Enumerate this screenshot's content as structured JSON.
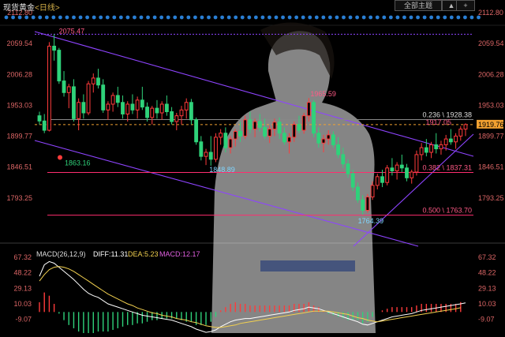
{
  "header": {
    "title": "现货黄金",
    "timeframe": "<日线>",
    "all_button": "全部主题",
    "up_button": "▲",
    "plus_button": "+"
  },
  "colors": {
    "background": "#000000",
    "up_candle": "#ff3b3b",
    "down_candle": "#2fd27a",
    "channel": "#8e44ff",
    "fib_line": "#ff2d6f",
    "fib_label": "#ff5a86",
    "diff": "#ffffff",
    "dea": "#f2d04f",
    "macd_pos": "#ff3b3b",
    "macd_neg": "#2fd27a",
    "dots": "#2a7fd4"
  },
  "chart_data": [
    {
      "type": "candlestick",
      "title": "现货黄金 日线",
      "y_ticks": [
        "2112.80",
        "2059.54",
        "2006.28",
        "1953.03",
        "1899.77",
        "1846.51",
        "1793.25"
      ],
      "right_ticks": [
        "2112.80",
        "2059.54",
        "2006.28",
        "1953.03",
        "1919.76",
        "1899.77",
        "1846.51",
        "1793.25"
      ],
      "ylim": [
        1740,
        2112.8
      ],
      "current_price": "1919.76",
      "annotations": [
        "2075.47",
        "1863.16",
        "1848.89",
        "1965.59",
        "1764.39",
        "1917.05"
      ],
      "fib_levels": [
        {
          "label": "0.236 \\ 1928.38",
          "value": 1928.38
        },
        {
          "label": "0.382 \\ 1837.31",
          "value": 1837.31
        },
        {
          "label": "0.500 \\ 1763.70",
          "value": 1763.7
        }
      ],
      "candles": [
        [
          1935,
          1942,
          1920,
          1926
        ],
        [
          1926,
          1938,
          1905,
          1910
        ],
        [
          1910,
          2062,
          1908,
          2055
        ],
        [
          2055,
          2075.47,
          2030,
          2048
        ],
        [
          2048,
          2052,
          1990,
          1995
        ],
        [
          1995,
          2012,
          1968,
          1975
        ],
        [
          1975,
          1990,
          1948,
          1985
        ],
        [
          1985,
          1998,
          1925,
          1930
        ],
        [
          1930,
          1965,
          1910,
          1958
        ],
        [
          1958,
          1972,
          1930,
          1940
        ],
        [
          1940,
          1995,
          1936,
          1990
        ],
        [
          1990,
          2008,
          1975,
          2000
        ],
        [
          2000,
          2016,
          1982,
          1988
        ],
        [
          1988,
          1998,
          1940,
          1945
        ],
        [
          1945,
          1960,
          1928,
          1955
        ],
        [
          1955,
          1975,
          1942,
          1970
        ],
        [
          1970,
          1985,
          1950,
          1958
        ],
        [
          1958,
          1970,
          1930,
          1938
        ],
        [
          1938,
          1960,
          1925,
          1955
        ],
        [
          1955,
          1972,
          1938,
          1945
        ],
        [
          1945,
          1968,
          1930,
          1962
        ],
        [
          1962,
          1985,
          1945,
          1950
        ],
        [
          1950,
          1958,
          1925,
          1932
        ],
        [
          1932,
          1952,
          1920,
          1948
        ],
        [
          1948,
          1962,
          1930,
          1940
        ],
        [
          1940,
          1960,
          1928,
          1955
        ],
        [
          1955,
          1970,
          1935,
          1942
        ],
        [
          1942,
          1950,
          1920,
          1925
        ],
        [
          1925,
          1940,
          1910,
          1935
        ],
        [
          1935,
          1952,
          1920,
          1945
        ],
        [
          1945,
          1965,
          1930,
          1958
        ],
        [
          1958,
          1964,
          1920,
          1928
        ],
        [
          1928,
          1932,
          1885,
          1890
        ],
        [
          1890,
          1900,
          1858,
          1865
        ],
        [
          1865,
          1878,
          1850,
          1872
        ],
        [
          1872,
          1900,
          1848.89,
          1860
        ],
        [
          1860,
          1905,
          1855,
          1898
        ],
        [
          1898,
          1912,
          1885,
          1905
        ],
        [
          1905,
          1915,
          1872,
          1880
        ],
        [
          1880,
          1900,
          1870,
          1895
        ],
        [
          1895,
          1912,
          1882,
          1908
        ],
        [
          1908,
          1925,
          1890,
          1900
        ],
        [
          1900,
          1935,
          1895,
          1928
        ],
        [
          1928,
          1942,
          1905,
          1912
        ],
        [
          1912,
          1930,
          1898,
          1925
        ],
        [
          1925,
          1938,
          1908,
          1915
        ],
        [
          1915,
          1930,
          1895,
          1900
        ],
        [
          1900,
          1918,
          1888,
          1912
        ],
        [
          1912,
          1930,
          1900,
          1924
        ],
        [
          1924,
          1932,
          1895,
          1905
        ],
        [
          1905,
          1915,
          1885,
          1890
        ],
        [
          1890,
          1905,
          1870,
          1898
        ],
        [
          1898,
          1925,
          1890,
          1920
        ],
        [
          1920,
          1935,
          1905,
          1910
        ],
        [
          1910,
          1940,
          1904,
          1935
        ],
        [
          1935,
          1965.59,
          1925,
          1958
        ],
        [
          1958,
          1962,
          1898,
          1905
        ],
        [
          1905,
          1915,
          1880,
          1888
        ],
        [
          1888,
          1902,
          1872,
          1895
        ],
        [
          1895,
          1910,
          1885,
          1902
        ],
        [
          1902,
          1908,
          1880,
          1885
        ],
        [
          1885,
          1898,
          1862,
          1868
        ],
        [
          1868,
          1880,
          1845,
          1852
        ],
        [
          1852,
          1860,
          1828,
          1835
        ],
        [
          1835,
          1842,
          1805,
          1812
        ],
        [
          1812,
          1820,
          1785,
          1790
        ],
        [
          1790,
          1798,
          1764.39,
          1772
        ],
        [
          1772,
          1800,
          1768,
          1795
        ],
        [
          1795,
          1822,
          1790,
          1815
        ],
        [
          1815,
          1835,
          1808,
          1830
        ],
        [
          1830,
          1842,
          1812,
          1820
        ],
        [
          1820,
          1850,
          1815,
          1845
        ],
        [
          1845,
          1862,
          1832,
          1840
        ],
        [
          1840,
          1855,
          1825,
          1850
        ],
        [
          1850,
          1868,
          1838,
          1845
        ],
        [
          1845,
          1852,
          1822,
          1828
        ],
        [
          1828,
          1842,
          1818,
          1838
        ],
        [
          1838,
          1875,
          1832,
          1868
        ],
        [
          1868,
          1888,
          1858,
          1880
        ],
        [
          1880,
          1895,
          1865,
          1872
        ],
        [
          1872,
          1890,
          1862,
          1885
        ],
        [
          1885,
          1905,
          1870,
          1878
        ],
        [
          1878,
          1892,
          1868,
          1885
        ],
        [
          1885,
          1902,
          1875,
          1895
        ],
        [
          1895,
          1912,
          1885,
          1890
        ],
        [
          1890,
          1905,
          1878,
          1900
        ],
        [
          1900,
          1917.05,
          1892,
          1912
        ],
        [
          1912,
          1922,
          1900,
          1919.76
        ]
      ]
    },
    {
      "type": "bar",
      "title": "MACD(26,12,9)",
      "legend": {
        "diff": "DIFF:11.31",
        "dea": "DEA:5.23",
        "macd": "MACD:12.17"
      },
      "y_ticks": [
        "67.32",
        "48.22",
        "29.13",
        "10.03",
        "-9.07"
      ],
      "ylim": [
        -22,
        75
      ],
      "diff": [
        44,
        58,
        62,
        60,
        55,
        50,
        45,
        40,
        34,
        28,
        23,
        20,
        18,
        14,
        10,
        8,
        6,
        4,
        2,
        0,
        -2,
        -4,
        -5,
        -6,
        -7,
        -8,
        -9,
        -10,
        -12,
        -14,
        -16,
        -18,
        -21,
        -23,
        -25,
        -24,
        -22,
        -18,
        -15,
        -12,
        -10,
        -9,
        -8,
        -8,
        -7,
        -6,
        -5,
        -4,
        -3,
        -2,
        -1,
        0,
        2,
        3,
        4,
        6,
        5,
        4,
        2,
        0,
        -2,
        -4,
        -6,
        -8,
        -10,
        -12,
        -15,
        -16,
        -14,
        -12,
        -10,
        -8,
        -6,
        -5,
        -4,
        -3,
        -2,
        0,
        2,
        3,
        4,
        5,
        6,
        7,
        8,
        9,
        10,
        11.31
      ],
      "dea": [
        38,
        46,
        52,
        55,
        56,
        55,
        53,
        50,
        46,
        42,
        38,
        34,
        30,
        26,
        22,
        19,
        16,
        13,
        10,
        8,
        5,
        3,
        1,
        -1,
        -2,
        -4,
        -5,
        -6,
        -8,
        -9,
        -10,
        -12,
        -13,
        -15,
        -17,
        -18,
        -19,
        -19,
        -18,
        -17,
        -16,
        -14,
        -13,
        -12,
        -11,
        -10,
        -9,
        -8,
        -7,
        -6,
        -5,
        -4,
        -3,
        -2,
        -1,
        0,
        1,
        1,
        1,
        1,
        0,
        -1,
        -2,
        -3,
        -5,
        -7,
        -8,
        -10,
        -11,
        -12,
        -11,
        -10,
        -9,
        -8,
        -7,
        -6,
        -5,
        -4,
        -3,
        -2,
        -1,
        0,
        1,
        2,
        3,
        4,
        5.23
      ],
      "macd": [
        12,
        24,
        20,
        10,
        -2,
        -10,
        -16,
        -20,
        -24,
        -28,
        -30,
        -28,
        -24,
        -24,
        -24,
        -22,
        -20,
        -18,
        -16,
        -16,
        -14,
        -14,
        -12,
        -10,
        -10,
        -8,
        -8,
        -8,
        -8,
        -10,
        -12,
        -12,
        -16,
        -16,
        -16,
        -12,
        -6,
        2,
        6,
        10,
        12,
        10,
        10,
        8,
        8,
        8,
        8,
        8,
        8,
        8,
        8,
        8,
        10,
        10,
        10,
        12,
        8,
        6,
        2,
        -2,
        -4,
        -6,
        -8,
        -10,
        -10,
        -10,
        -14,
        -12,
        -6,
        0,
        2,
        4,
        6,
        6,
        6,
        6,
        6,
        8,
        10,
        10,
        10,
        10,
        10,
        10,
        10,
        10,
        12.17
      ]
    }
  ]
}
